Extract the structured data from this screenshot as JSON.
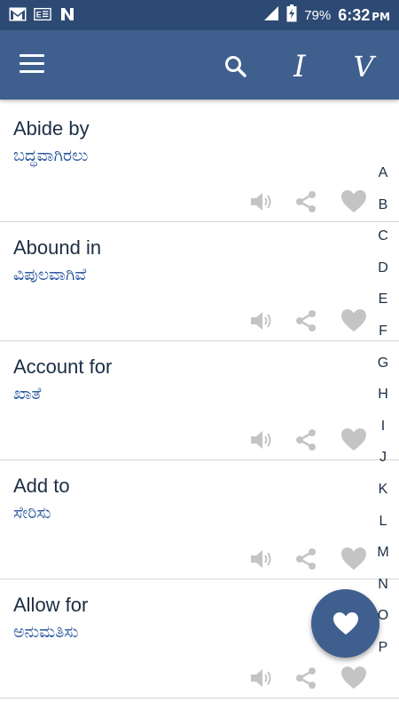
{
  "status_bar": {
    "battery_percent": "79%",
    "time": "6:32",
    "ampm": "PM",
    "icons": [
      "gmail-icon",
      "e-reader-icon",
      "n-notification-icon",
      "signal-icon",
      "battery-charging-icon"
    ]
  },
  "app_bar": {
    "icons": [
      "menu-icon",
      "search-icon"
    ],
    "i_label": "I",
    "v_label": "V"
  },
  "entries": [
    {
      "word": "Abide by",
      "meaning": "ಬದ್ಧವಾಗಿರಲು"
    },
    {
      "word": "Abound in",
      "meaning": "ವಿಪುಲವಾಗಿವೆ"
    },
    {
      "word": "Account for",
      "meaning": "ಖಾತೆ"
    },
    {
      "word": "Add to",
      "meaning": "ಸೇರಿಸು"
    },
    {
      "word": "Allow for",
      "meaning": "ಅನುಮತಿಸು"
    }
  ],
  "entry_actions": [
    "speaker-icon",
    "share-icon",
    "heart-icon"
  ],
  "alphabet": [
    "A",
    "B",
    "C",
    "D",
    "E",
    "F",
    "G",
    "H",
    "I",
    "J",
    "K",
    "L",
    "M",
    "N",
    "O",
    "P"
  ],
  "colors": {
    "status_bar": "#2d4a74",
    "app_bar": "#3f5f8f",
    "meaning_text": "#2c5aa0",
    "icon_gray": "#c4c4c4"
  },
  "fab": {
    "icon": "heart-icon"
  }
}
